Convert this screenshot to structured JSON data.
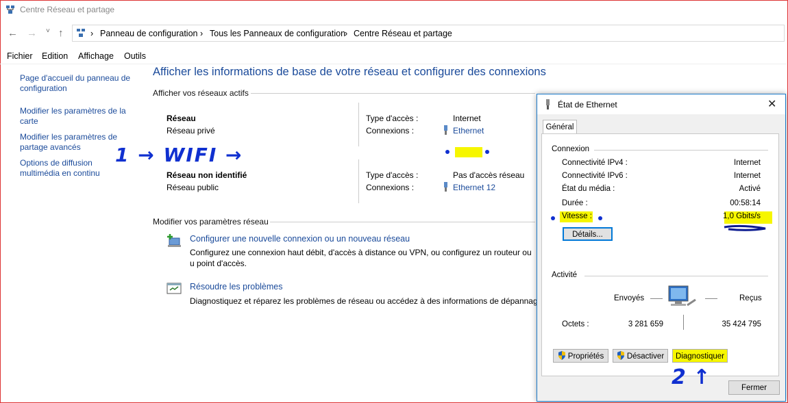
{
  "window": {
    "title": "Centre Réseau et partage"
  },
  "address": {
    "crumbs": [
      "Panneau de configuration",
      "Tous les Panneaux de configuration",
      "Centre Réseau et partage"
    ]
  },
  "menu": [
    "Fichier",
    "Edition",
    "Affichage",
    "Outils"
  ],
  "sidebar": [
    {
      "label": "Page d'accueil du panneau de configuration"
    },
    {
      "label": "Modifier les paramètres de la carte"
    },
    {
      "label": "Modifier les paramètres de partage avancés"
    },
    {
      "label": "Options de diffusion multimédia en continu"
    }
  ],
  "main": {
    "heading": "Afficher les informations de base de votre réseau et configurer des connexions",
    "active_title": "Afficher vos réseaux actifs",
    "networks": [
      {
        "name": "Réseau",
        "type": "Réseau privé",
        "access_label": "Type d'accès :",
        "access": "Internet",
        "conn_label": "Connexions :",
        "conn": "Ethernet"
      },
      {
        "name": "Réseau non identifié",
        "type": "Réseau public",
        "access_label": "Type d'accès :",
        "access": "Pas d'accès réseau",
        "conn_label": "Connexions :",
        "conn": "Ethernet 12"
      }
    ],
    "modify_title": "Modifier vos paramètres réseau",
    "tasks": [
      {
        "title": "Configurer une nouvelle connexion ou un nouveau réseau",
        "desc": "Configurez une connexion haut débit, d'accès à distance ou VPN, ou configurez un routeur ou u point d'accès."
      },
      {
        "title": "Résoudre les problèmes",
        "desc": "Diagnostiquez et réparez les problèmes de réseau ou accédez à des informations de dépannage."
      }
    ]
  },
  "dialog": {
    "title": "État de Ethernet",
    "tab": "Général",
    "connection_group": "Connexion",
    "rows": [
      {
        "label": "Connectivité IPv4 :",
        "value": "Internet"
      },
      {
        "label": "Connectivité IPv6 :",
        "value": "Internet"
      },
      {
        "label": "État du média :",
        "value": "Activé"
      },
      {
        "label": "Durée :",
        "value": "00:58:14"
      },
      {
        "label": "Vitesse :",
        "value": "1,0 Gbits/s"
      }
    ],
    "details_btn": "Détails...",
    "activity_group": "Activité",
    "sent_label": "Envoyés",
    "recv_label": "Reçus",
    "bytes_label": "Octets :",
    "sent_value": "3 281 659",
    "recv_value": "35 424 795",
    "btn_properties": "Propriétés",
    "btn_disable": "Désactiver",
    "btn_diagnose": "Diagnostiquer",
    "btn_close": "Fermer"
  },
  "annotations": {
    "arrow1": "1 → WIFI →",
    "arrow2": "2 ↑"
  }
}
